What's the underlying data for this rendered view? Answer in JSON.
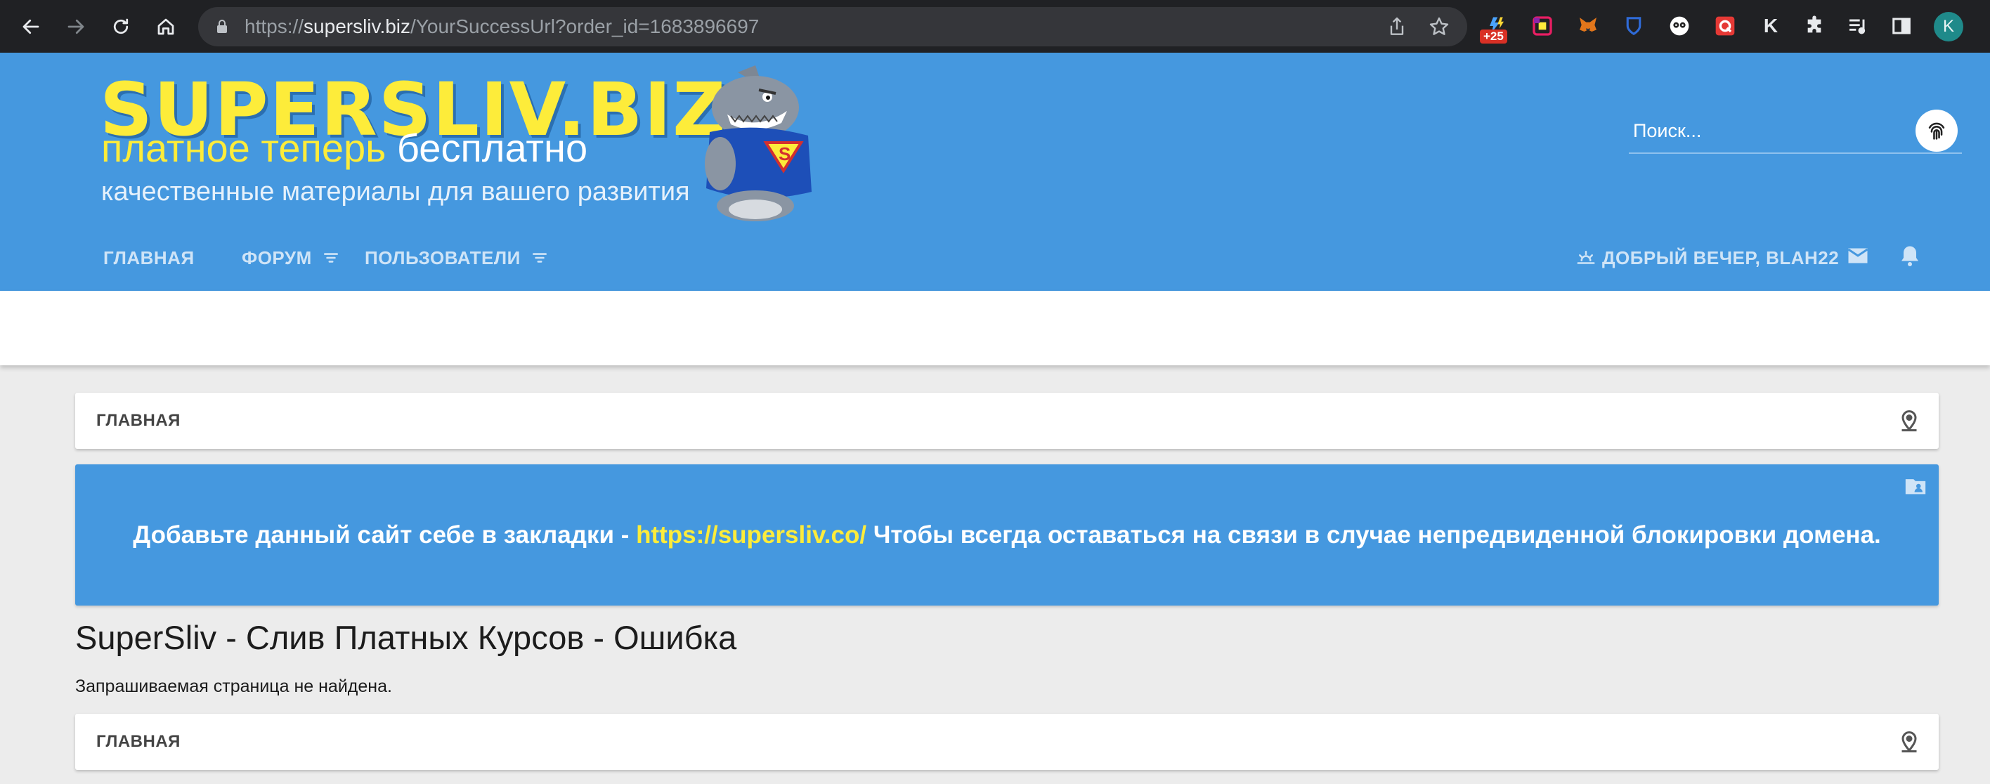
{
  "browser": {
    "url_scheme": "https://",
    "url_host": "supersliv.biz",
    "url_path": "/YourSuccessUrl?order_id=1683896697",
    "extension_badge": "+25",
    "extensions": [
      "lightning-extension-icon",
      "color-picker-extension-icon",
      "metamask-fox-icon",
      "bitwarden-shield-icon",
      "owl-extension-icon",
      "red-q-extension-icon",
      "k-extension-icon",
      "puzzle-icon",
      "playlist-icon",
      "sidepanel-icon"
    ],
    "k_extension_label": "K",
    "profile_initial": "K"
  },
  "header": {
    "logo_title": "SUPERSLIV.BIZ",
    "tagline_yellow": "платное теперь",
    "tagline_white": "бесплатно",
    "subtagline": "качественные материалы для вашего развития",
    "search_placeholder": "Поиск...",
    "nav": {
      "home": "ГЛАВНАЯ",
      "forum": "ФОРУМ",
      "users": "ПОЛЬЗОВАТЕЛИ"
    },
    "greeting": "ДОБРЫЙ ВЕЧЕР, BLAH22"
  },
  "breadcrumb_top": "ГЛАВНАЯ",
  "notice": {
    "before": "Добавьте данный сайт себе в закладки - ",
    "link": "https://supersliv.co/",
    "after": " Чтобы всегда оставаться на связи в случае непредвиденной блокировки домена."
  },
  "page_title": "SuperSliv - Слив Платных Курсов - Ошибка",
  "error_message": "Запрашиваемая страница не найдена.",
  "breadcrumb_bottom": "ГЛАВНАЯ",
  "colors": {
    "header_blue": "#4598df",
    "logo_yellow": "#fdec3a",
    "chrome_dark": "#202124",
    "page_bg": "#ececec"
  }
}
